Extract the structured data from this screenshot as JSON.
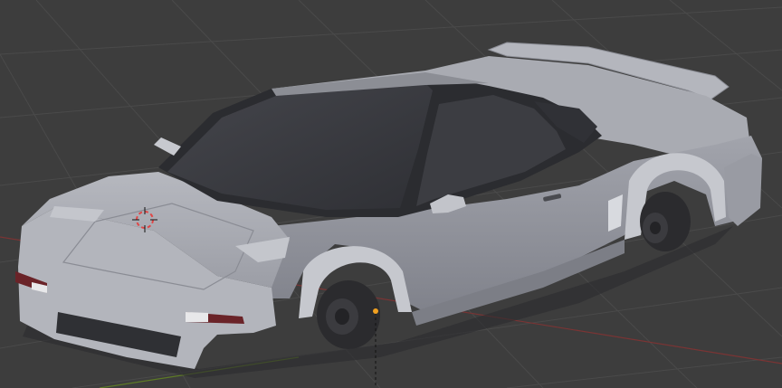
{
  "viewport": {
    "background": "#3d3d3d",
    "grid_color": "#4a4a4a",
    "x_axis_color": "#8a3a3a",
    "y_axis_color": "#6a8a2a"
  },
  "model": {
    "body_color": "#a4a6ae",
    "body_shadow": "#7d7f88",
    "glass_color": "#3a3b40",
    "trim_color": "#2a2a2e",
    "tire_color": "#2b2b2e",
    "taillight_color": "#6a2328"
  },
  "cursor": {
    "icon": "3d-cursor-icon",
    "ring_color": "#e04646"
  },
  "origin": {
    "icon": "object-origin-icon",
    "color": "#f0a020"
  }
}
